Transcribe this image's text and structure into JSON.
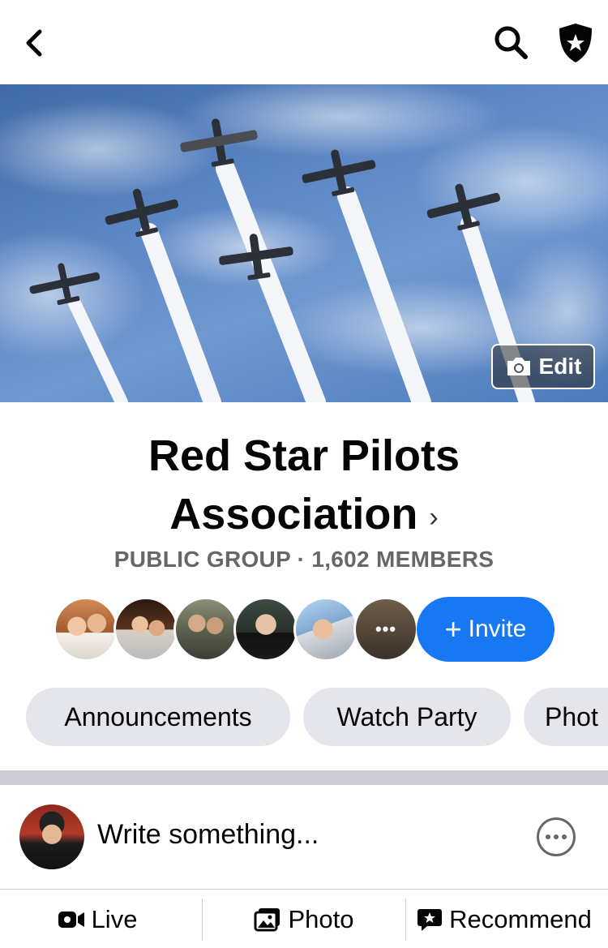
{
  "topbar": {
    "back_icon": "chevron-left-icon",
    "search_icon": "search-icon",
    "admin_icon": "shield-star-icon"
  },
  "cover": {
    "edit_label": "Edit",
    "edit_icon": "camera-icon"
  },
  "group": {
    "name_line1": "Red Star Pilots",
    "name_line2": "Association",
    "meta": "PUBLIC GROUP · 1,602 MEMBERS"
  },
  "members": {
    "more_label": "•••",
    "invite_label": "Invite",
    "invite_icon": "plus-icon"
  },
  "chips": [
    {
      "label": "Announcements"
    },
    {
      "label": "Watch Party"
    },
    {
      "label": "Phot"
    }
  ],
  "composer": {
    "placeholder": "Write something...",
    "more_icon": "more-icon"
  },
  "actions": [
    {
      "label": "Live",
      "icon": "video-icon"
    },
    {
      "label": "Photo",
      "icon": "photo-icon"
    },
    {
      "label": "Recommend",
      "icon": "recommend-icon"
    }
  ],
  "colors": {
    "accent": "#1877f2",
    "chip_bg": "#e4e6eb",
    "secondary_text": "#65676b"
  }
}
